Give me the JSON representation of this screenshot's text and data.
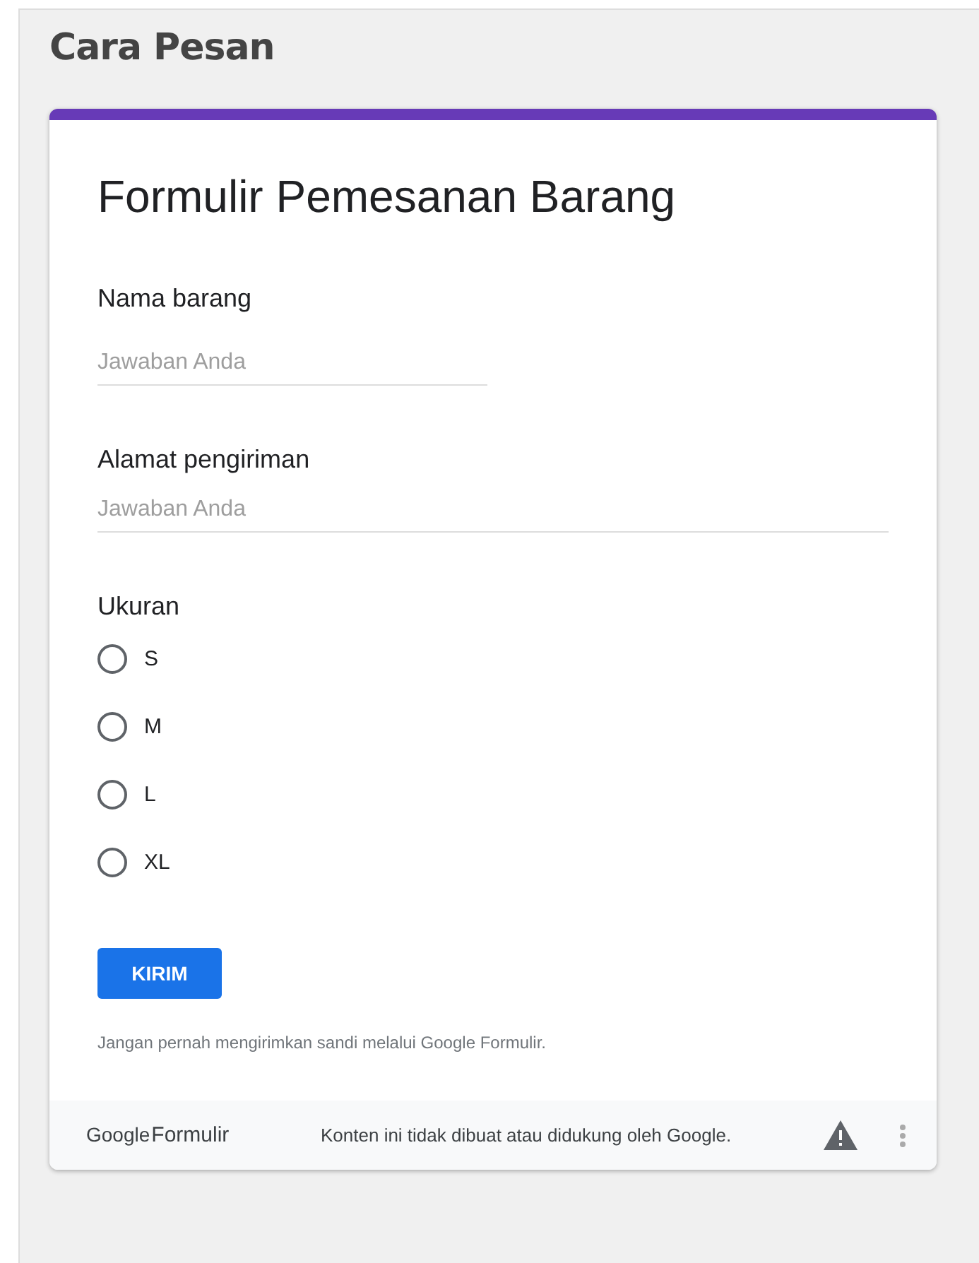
{
  "page_title": "Cara Pesan",
  "form": {
    "title": "Formulir Pemesanan Barang",
    "questions": [
      {
        "kind": "short",
        "label": "Nama barang",
        "placeholder": "Jawaban Anda"
      },
      {
        "kind": "long",
        "label": "Alamat pengiriman",
        "placeholder": "Jawaban Anda"
      },
      {
        "kind": "radio",
        "label": "Ukuran",
        "options": [
          {
            "label": "S",
            "selected": false
          },
          {
            "label": "M",
            "selected": false
          },
          {
            "label": "L",
            "selected": false
          },
          {
            "label": "XL",
            "selected": false
          }
        ]
      }
    ],
    "submit": "KIRIM",
    "note": "Jangan pernah mengirimkan sandi melalui Google Formulir."
  },
  "footer": {
    "logo_brand": "Google",
    "logo_product": "Formulir",
    "disclaimer": "Konten ini tidak dibuat atau didukung oleh Google."
  }
}
